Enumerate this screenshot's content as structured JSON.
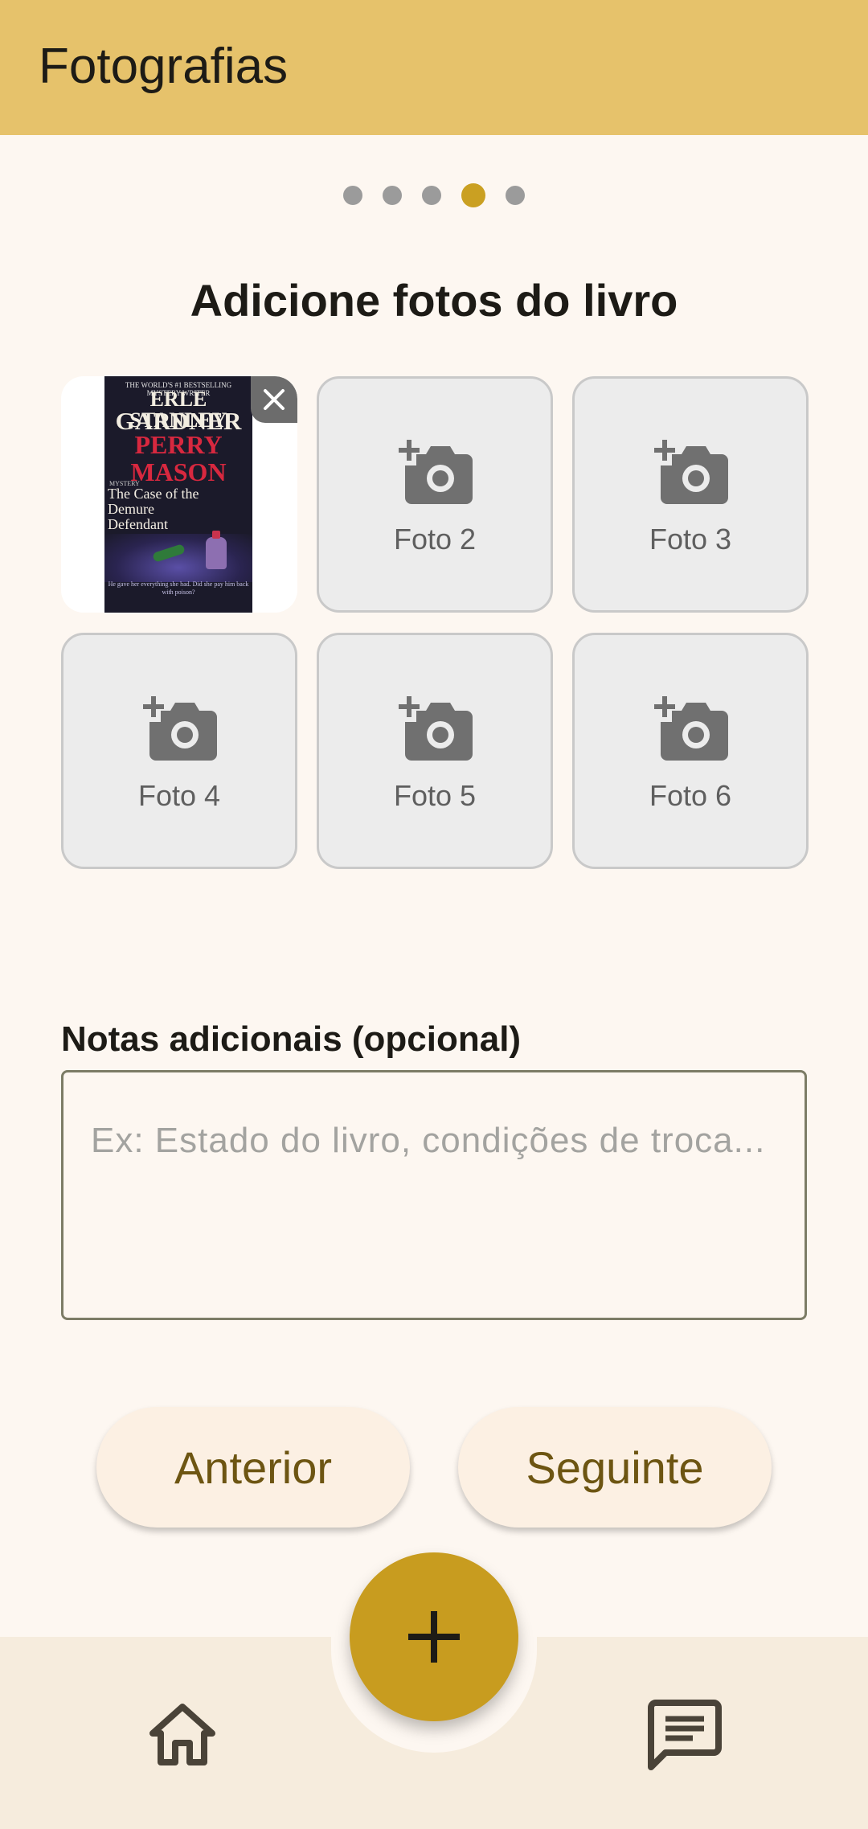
{
  "app_bar": {
    "title": "Fotografias"
  },
  "stepper": {
    "total_steps": 5,
    "current_step": 4
  },
  "main": {
    "section_title": "Adicione fotos do livro",
    "photos": [
      {
        "label": "",
        "filled": true
      },
      {
        "label": "Foto 2",
        "filled": false
      },
      {
        "label": "Foto 3",
        "filled": false
      },
      {
        "label": "Foto 4",
        "filled": false
      },
      {
        "label": "Foto 5",
        "filled": false
      },
      {
        "label": "Foto 6",
        "filled": false
      }
    ],
    "book_cover": {
      "top_line": "THE WORLD'S #1 BESTSELLING MYSTERY WRITER",
      "author_first": "ERLE STANLEY",
      "author_last": "GARDNER",
      "series": "PERRY MASON",
      "genre": "MYSTERY",
      "subtitle": "The Case of the Demure Defendant",
      "blurb": "He gave her everything she had. Did she pay him back with poison?"
    },
    "notes": {
      "label": "Notas adicionais (opcional)",
      "placeholder": "Ex: Estado do livro, condições de troca...",
      "value": ""
    },
    "buttons": {
      "previous": "Anterior",
      "next": "Seguinte"
    }
  },
  "bottom_nav": {
    "fab_icon": "plus-icon",
    "left_icon": "home-icon",
    "right_icon": "chat-icon"
  },
  "colors": {
    "app_bar": "#e6c26b",
    "accent": "#caa022",
    "fab": "#c89c1f",
    "button_text": "#6d5512",
    "background": "#fdf7f1"
  }
}
